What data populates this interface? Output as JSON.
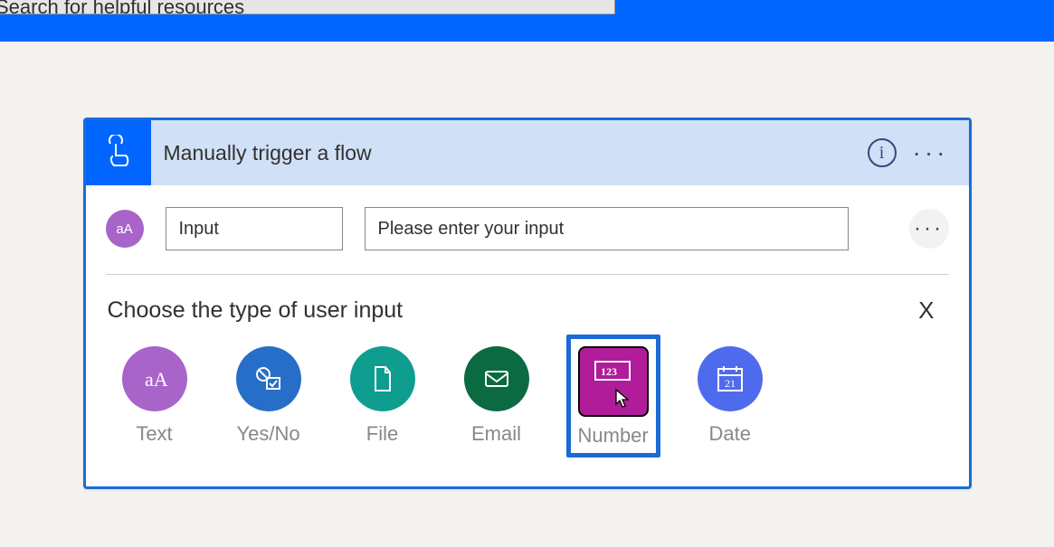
{
  "search": {
    "placeholder": "Search for helpful resources"
  },
  "trigger": {
    "title": "Manually trigger a flow",
    "info_tooltip": "i",
    "menu": "···"
  },
  "param": {
    "badge": "aA",
    "name": "Input",
    "prompt": "Please enter your input",
    "menu": "···"
  },
  "choose": {
    "title": "Choose the type of user input",
    "close": "X",
    "types": [
      {
        "id": "text",
        "label": "Text",
        "icon": "text"
      },
      {
        "id": "yesno",
        "label": "Yes/No",
        "icon": "yesno"
      },
      {
        "id": "file",
        "label": "File",
        "icon": "file"
      },
      {
        "id": "email",
        "label": "Email",
        "icon": "email"
      },
      {
        "id": "number",
        "label": "Number",
        "icon": "number",
        "selected": true
      },
      {
        "id": "date",
        "label": "Date",
        "icon": "date"
      }
    ]
  }
}
